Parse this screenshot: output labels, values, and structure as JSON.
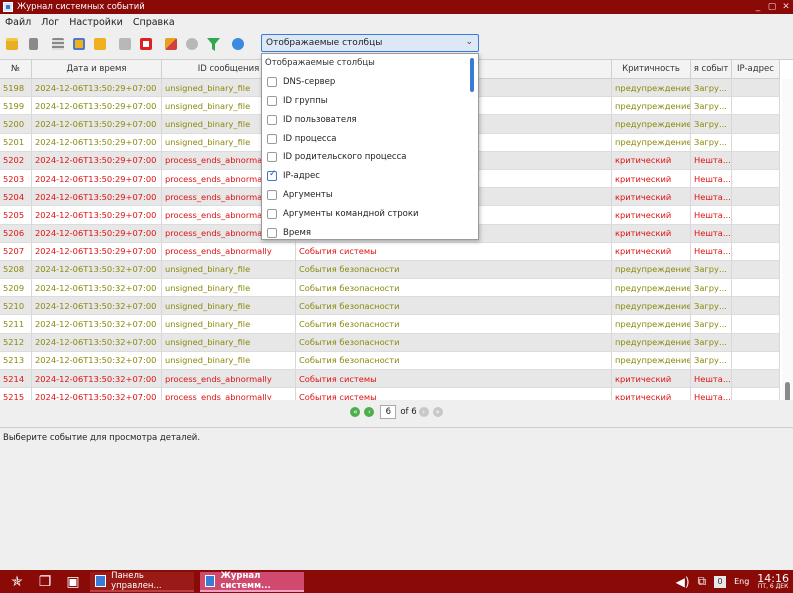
{
  "window": {
    "title": "Журнал системных событий",
    "min": "_",
    "max": "▢",
    "close": "✕"
  },
  "menu": [
    "Файл",
    "Лог",
    "Настройки",
    "Справка"
  ],
  "toolbar": {
    "icons": [
      "open-folder",
      "document",
      "list",
      "save",
      "export",
      "play",
      "stop",
      "clear",
      "refresh",
      "filter",
      "info"
    ],
    "columns_combo": "Отображаемые столбцы"
  },
  "table": {
    "headers": [
      "№",
      "Дата и время",
      "ID сообщения",
      "",
      "Критичность",
      "я событ",
      "IP-адрес"
    ],
    "rows": [
      {
        "n": "5198",
        "dt": "2024-12-06T13:50:29+07:00",
        "id": "unsigned_binary_file",
        "src": "",
        "sev": "предупреждение",
        "ev": "Загру...",
        "ip": "",
        "level": "warn"
      },
      {
        "n": "5199",
        "dt": "2024-12-06T13:50:29+07:00",
        "id": "unsigned_binary_file",
        "src": "",
        "sev": "предупреждение",
        "ev": "Загру...",
        "ip": "",
        "level": "warn"
      },
      {
        "n": "5200",
        "dt": "2024-12-06T13:50:29+07:00",
        "id": "unsigned_binary_file",
        "src": "",
        "sev": "предупреждение",
        "ev": "Загру...",
        "ip": "",
        "level": "warn"
      },
      {
        "n": "5201",
        "dt": "2024-12-06T13:50:29+07:00",
        "id": "unsigned_binary_file",
        "src": "",
        "sev": "предупреждение",
        "ev": "Загру...",
        "ip": "",
        "level": "warn"
      },
      {
        "n": "5202",
        "dt": "2024-12-06T13:50:29+07:00",
        "id": "process_ends_abnorma",
        "src": "",
        "sev": "критический",
        "ev": "Нешта...",
        "ip": "",
        "level": "crit"
      },
      {
        "n": "5203",
        "dt": "2024-12-06T13:50:29+07:00",
        "id": "process_ends_abnorma",
        "src": "",
        "sev": "критический",
        "ev": "Нешта...",
        "ip": "",
        "level": "crit"
      },
      {
        "n": "5204",
        "dt": "2024-12-06T13:50:29+07:00",
        "id": "process_ends_abnorma",
        "src": "",
        "sev": "критический",
        "ev": "Нешта...",
        "ip": "",
        "level": "crit"
      },
      {
        "n": "5205",
        "dt": "2024-12-06T13:50:29+07:00",
        "id": "process_ends_abnorma",
        "src": "",
        "sev": "критический",
        "ev": "Нешта...",
        "ip": "",
        "level": "crit"
      },
      {
        "n": "5206",
        "dt": "2024-12-06T13:50:29+07:00",
        "id": "process_ends_abnorma",
        "src": "",
        "sev": "критический",
        "ev": "Нешта...",
        "ip": "",
        "level": "crit"
      },
      {
        "n": "5207",
        "dt": "2024-12-06T13:50:29+07:00",
        "id": "process_ends_abnormally",
        "src": "События системы",
        "sev": "критический",
        "ev": "Нешта...",
        "ip": "",
        "level": "crit"
      },
      {
        "n": "5208",
        "dt": "2024-12-06T13:50:32+07:00",
        "id": "unsigned_binary_file",
        "src": "События безопасности",
        "sev": "предупреждение",
        "ev": "Загру...",
        "ip": "",
        "level": "warn"
      },
      {
        "n": "5209",
        "dt": "2024-12-06T13:50:32+07:00",
        "id": "unsigned_binary_file",
        "src": "События безопасности",
        "sev": "предупреждение",
        "ev": "Загру...",
        "ip": "",
        "level": "warn"
      },
      {
        "n": "5210",
        "dt": "2024-12-06T13:50:32+07:00",
        "id": "unsigned_binary_file",
        "src": "События безопасности",
        "sev": "предупреждение",
        "ev": "Загру...",
        "ip": "",
        "level": "warn"
      },
      {
        "n": "5211",
        "dt": "2024-12-06T13:50:32+07:00",
        "id": "unsigned_binary_file",
        "src": "События безопасности",
        "sev": "предупреждение",
        "ev": "Загру...",
        "ip": "",
        "level": "warn"
      },
      {
        "n": "5212",
        "dt": "2024-12-06T13:50:32+07:00",
        "id": "unsigned_binary_file",
        "src": "События безопасности",
        "sev": "предупреждение",
        "ev": "Загру...",
        "ip": "",
        "level": "warn"
      },
      {
        "n": "5213",
        "dt": "2024-12-06T13:50:32+07:00",
        "id": "unsigned_binary_file",
        "src": "События безопасности",
        "sev": "предупреждение",
        "ev": "Загру...",
        "ip": "",
        "level": "warn"
      },
      {
        "n": "5214",
        "dt": "2024-12-06T13:50:32+07:00",
        "id": "process_ends_abnormally",
        "src": "События системы",
        "sev": "критический",
        "ev": "Нешта...",
        "ip": "",
        "level": "crit"
      },
      {
        "n": "5215",
        "dt": "2024-12-06T13:50:32+07:00",
        "id": "process_ends_abnormally",
        "src": "События системы",
        "sev": "критический",
        "ev": "Нешта...",
        "ip": "",
        "level": "crit"
      }
    ]
  },
  "dropdown": {
    "header": "Отображаемые столбцы",
    "items": [
      {
        "label": "DNS-сервер",
        "checked": false
      },
      {
        "label": "ID группы",
        "checked": false
      },
      {
        "label": "ID пользователя",
        "checked": false
      },
      {
        "label": "ID процесса",
        "checked": false
      },
      {
        "label": "ID родительского процесса",
        "checked": false
      },
      {
        "label": "IP-адрес",
        "checked": true
      },
      {
        "label": "Аргументы",
        "checked": false
      },
      {
        "label": "Аргументы командной строки",
        "checked": false
      },
      {
        "label": "Время",
        "checked": false
      }
    ]
  },
  "pager": {
    "current": "6",
    "of_label": "of 6"
  },
  "detail": {
    "placeholder": "Выберите событие для просмотра деталей."
  },
  "taskbar": {
    "tasks": [
      {
        "label": "Панель управлен...",
        "active": false
      },
      {
        "label": "Журнал системм...",
        "active": true
      }
    ],
    "tray_number": "0",
    "lang": "Eng",
    "time": "14:16",
    "date": "ПТ, 6 ДЕК"
  },
  "colors": {
    "brand": "#8a0a08",
    "warn": "#8a8a0a",
    "crit": "#e01010",
    "accent": "#3a7bd5"
  }
}
